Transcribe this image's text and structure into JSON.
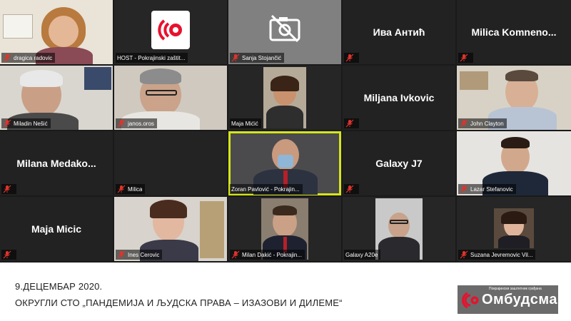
{
  "participants": {
    "dragica": "dragica radovic",
    "host": "HOST - Pokrajinski zaštit...",
    "sanja": "Sanja Stojančić",
    "iva": "Ива Антић",
    "milica_k": "Milica  Komneno...",
    "miladin": "Miladin Nešić",
    "janos": "janos.oros",
    "maja_m": "Maja Mićić",
    "miljana": "Miljana Ivkovic",
    "john": "John Clayton",
    "milana": "Milana  Medako...",
    "milica": "Milica",
    "zoran": "Zoran Pavlović - Pokrajin...",
    "galaxy_j7": "Galaxy J7",
    "lazar": "Lazar Stefanovic",
    "maja_micic": "Maja Micic",
    "ines": "Ines Cerovic",
    "milan": "Milan Dakić - Pokrajin...",
    "galaxy_a20e": "Galaxy A20e",
    "suzana": "Suzana Jevremovic Vil..."
  },
  "footer": {
    "date": "9.ДЕЦЕМБАР 2020.",
    "title": "ОКРУГЛИ СТО „ПАНДЕМИЈА И ЉУДСКА ПРАВА – ИЗАЗОВИ И ДИЛЕМЕ“"
  },
  "logo": {
    "tagline": "Покрајински заштитник грађана",
    "name": "Омбудсман"
  },
  "icons": {
    "muted_mic": "mic-off-icon",
    "video_off": "video-off-icon",
    "host_logo": "host-logo-icon"
  },
  "colors": {
    "active_speaker": "#d6e51a",
    "mute_icon": "#e0332b",
    "logo_accent": "#e8112d"
  }
}
